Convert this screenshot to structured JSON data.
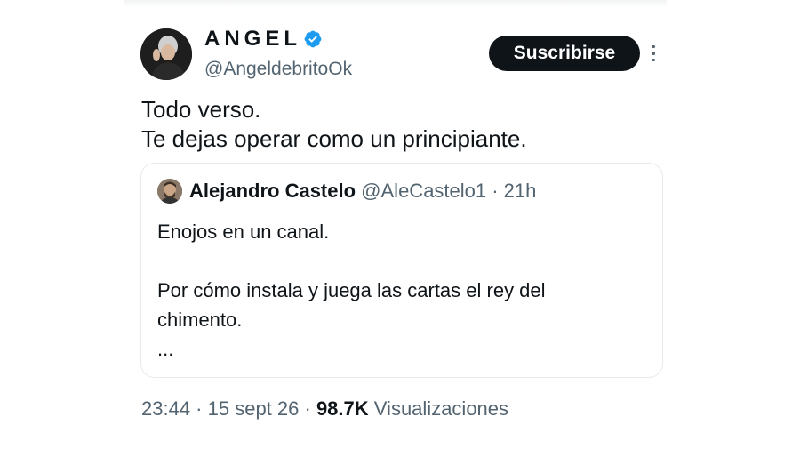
{
  "author": {
    "display_name": "ANGEL",
    "handle": "@AngeldebritoOk",
    "verified": true,
    "verified_color": "#1d9bf0"
  },
  "actions": {
    "subscribe_label": "Suscribirse",
    "more_icon": "more-vertical-icon"
  },
  "tweet": {
    "lines": [
      "Todo verso.",
      "Te dejas operar como un principiante."
    ]
  },
  "quoted_tweet": {
    "author_name": "Alejandro Castelo",
    "meta": "@AleCastelo1 · 21h",
    "lines": [
      "Enojos en un canal.",
      "Por cómo instala y juega las cartas el rey del",
      "chimento.",
      "..."
    ]
  },
  "footer": {
    "time": "23:44",
    "separator": " · ",
    "date": "15 sept 26",
    "views_count": "98.7K",
    "views_label": "Visualizaciones"
  }
}
